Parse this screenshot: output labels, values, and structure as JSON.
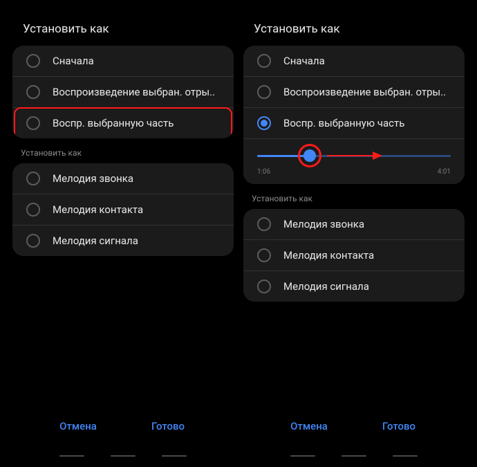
{
  "left": {
    "title": "Установить как",
    "options": [
      "Сначала",
      "Воспроизведение выбран. отры..",
      "Воспр. выбранную часть"
    ],
    "subTitle": "Установить как",
    "targets": [
      "Мелодия звонка",
      "Мелодия контакта",
      "Мелодия сигнала"
    ],
    "cancel": "Отмена",
    "done": "Готово"
  },
  "right": {
    "title": "Установить как",
    "options": [
      "Сначала",
      "Воспроизведение выбран. отры..",
      "Воспр. выбранную часть"
    ],
    "timeStart": "1:06",
    "timeEnd": "4:01",
    "subTitle": "Установить как",
    "targets": [
      "Мелодия звонка",
      "Мелодия контакта",
      "Мелодия сигнала"
    ],
    "cancel": "Отмена",
    "done": "Готово"
  }
}
